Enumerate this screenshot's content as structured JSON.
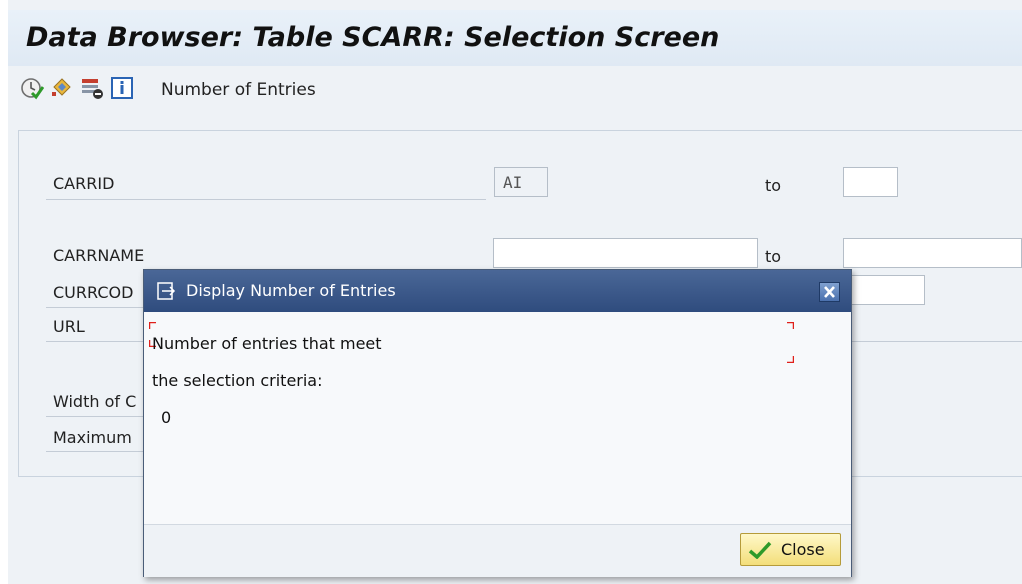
{
  "header": {
    "title": "Data Browser: Table SCARR: Selection Screen"
  },
  "toolbar": {
    "icons": [
      "execute-icon",
      "selection-options-icon",
      "delete-selection-icon",
      "info-icon"
    ],
    "number_entries_label": "Number of Entries"
  },
  "fields": {
    "carrid": {
      "label": "CARRID",
      "from": "AI",
      "to_label": "to",
      "to": ""
    },
    "carrname": {
      "label": "CARRNAME",
      "from": "",
      "to_label": "to",
      "to": ""
    },
    "currcode": {
      "label": "CURRCOD",
      "from": "",
      "to": ""
    },
    "url": {
      "label": "URL"
    },
    "width": {
      "label": "Width of C"
    },
    "maximum": {
      "label": "Maximum"
    }
  },
  "dialog": {
    "title": "Display Number of Entries",
    "line1": "Number of entries that meet",
    "line2": "the selection criteria:",
    "count": "0",
    "close_label": "Close"
  },
  "colors": {
    "dialog_header": "#3b5788",
    "close_button": "#f7e69a",
    "focus_corner": "#e0201a"
  }
}
